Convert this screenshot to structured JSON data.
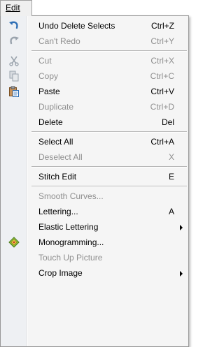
{
  "menu": {
    "title": "Edit"
  },
  "items": {
    "undo": {
      "label": "Undo Delete Selects",
      "shortcut": "Ctrl+Z"
    },
    "redo": {
      "label": "Can't Redo",
      "shortcut": "Ctrl+Y"
    },
    "cut": {
      "label": "Cut",
      "shortcut": "Ctrl+X"
    },
    "copy": {
      "label": "Copy",
      "shortcut": "Ctrl+C"
    },
    "paste": {
      "label": "Paste",
      "shortcut": "Ctrl+V"
    },
    "duplicate": {
      "label": "Duplicate",
      "shortcut": "Ctrl+D"
    },
    "delete": {
      "label": "Delete",
      "shortcut": "Del"
    },
    "select_all": {
      "label": "Select All",
      "shortcut": "Ctrl+A"
    },
    "deselect_all": {
      "label": "Deselect All",
      "shortcut": "X"
    },
    "stitch_edit": {
      "label": "Stitch Edit",
      "shortcut": "E"
    },
    "smooth": {
      "label": "Smooth Curves..."
    },
    "lettering": {
      "label": "Lettering...",
      "shortcut": "A"
    },
    "elastic": {
      "label": "Elastic Lettering"
    },
    "monogram": {
      "label": "Monogramming..."
    },
    "touchup": {
      "label": "Touch Up Picture"
    },
    "crop": {
      "label": "Crop Image"
    }
  },
  "icons": {
    "undo": "undo-arrow-icon",
    "redo": "redo-arrow-icon",
    "cut": "scissors-icon",
    "copy": "copy-pages-icon",
    "paste": "clipboard-icon",
    "monogram": "monogram-diamond-icon"
  },
  "colors": {
    "disabled_text": "#8f8f8f",
    "menu_bg": "#f5f5f5",
    "gutter_bg": "#eef0f3",
    "icon_blue": "#2f6fb5"
  }
}
